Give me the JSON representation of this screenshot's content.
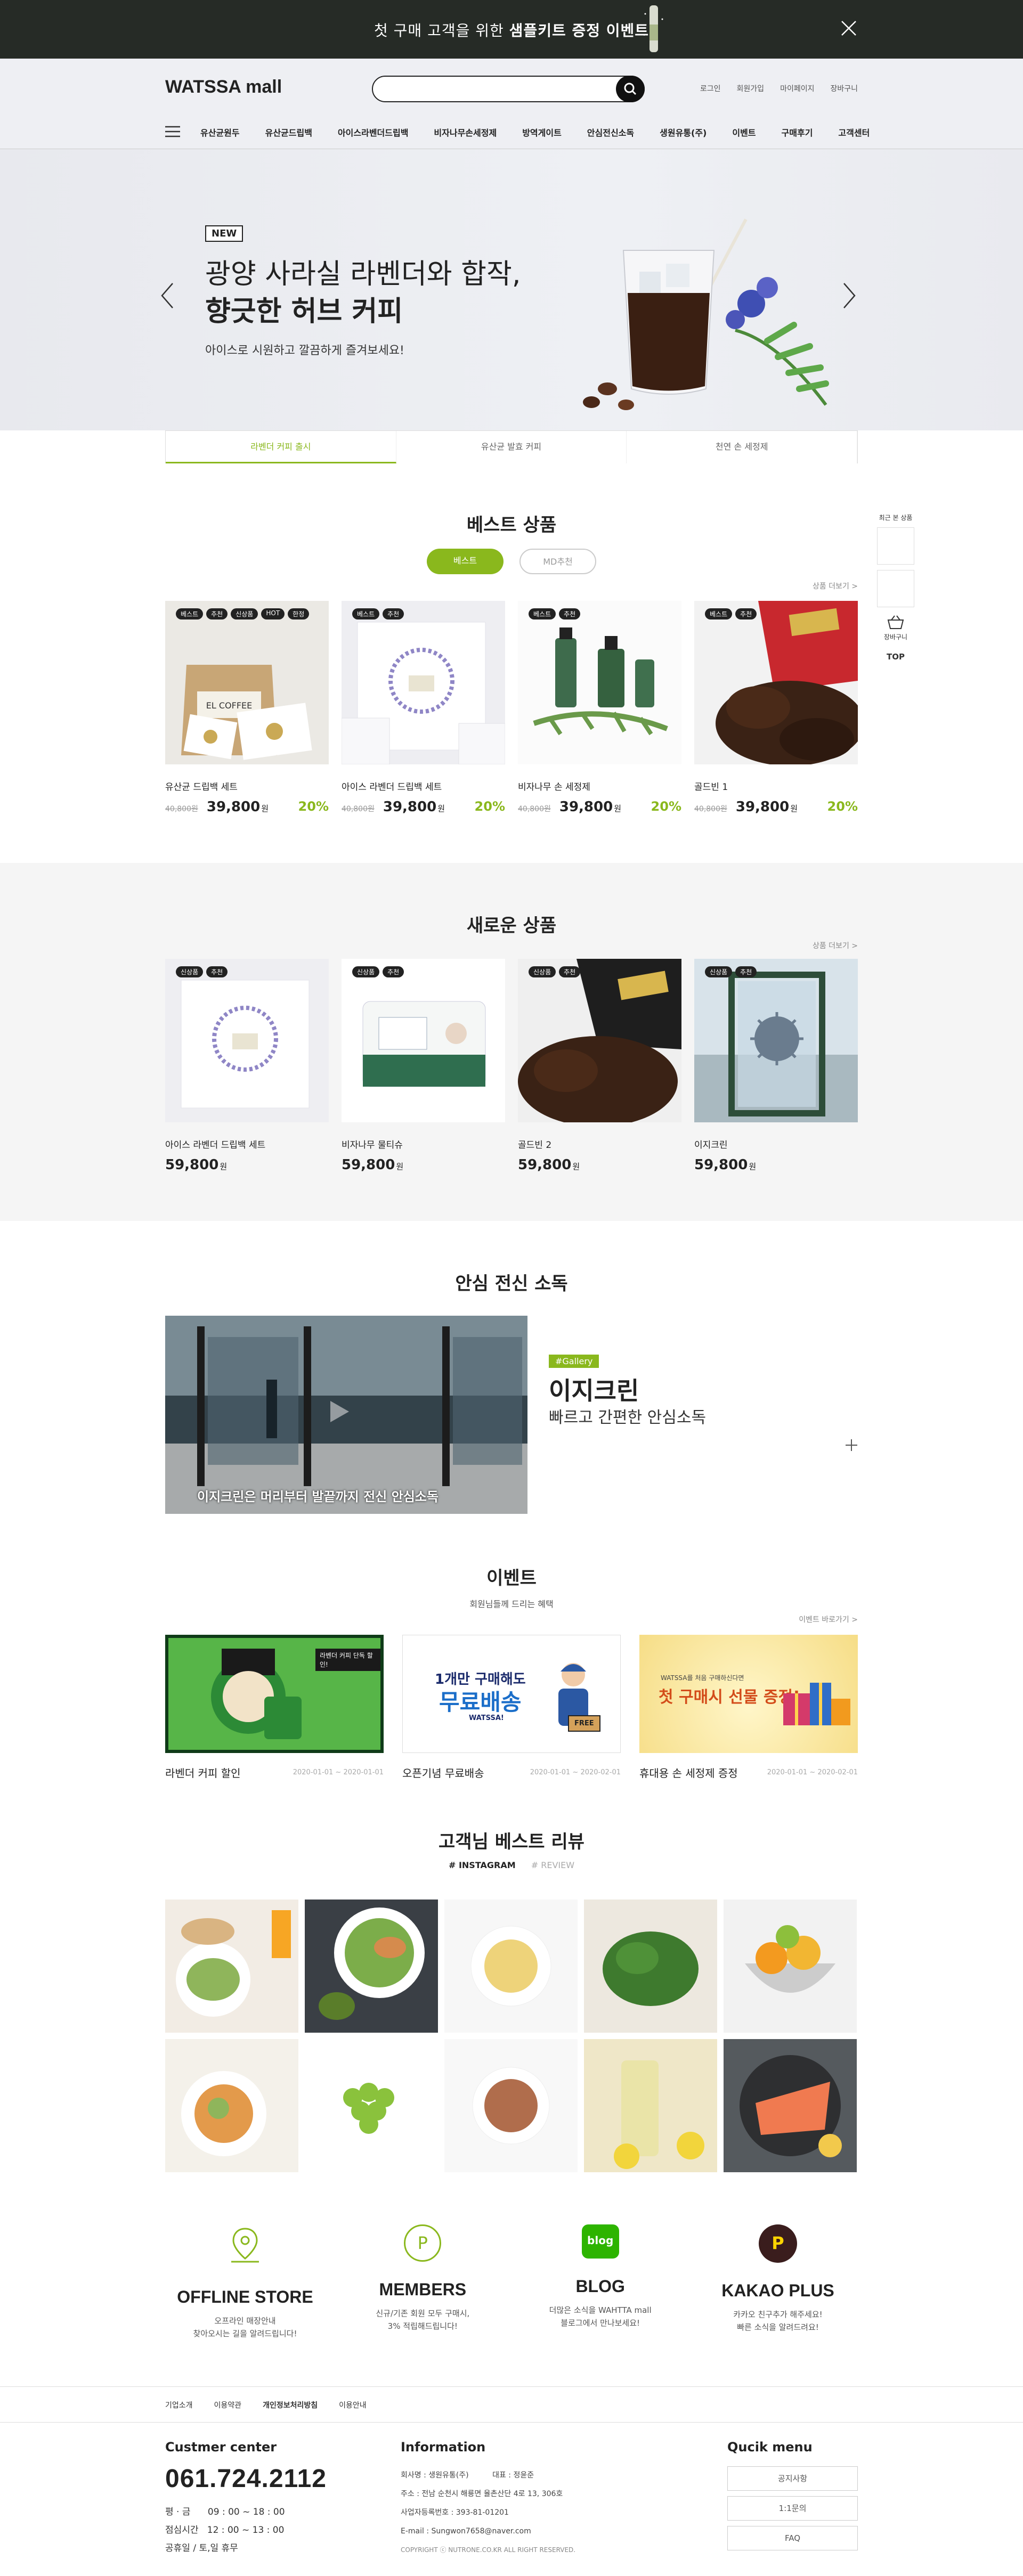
{
  "topbar": {
    "text_pre": "첫 구매 고객을 위한 ",
    "text_bold": "샘플키트 증정 이벤트"
  },
  "header": {
    "logo": "WATSSA mall",
    "search_placeholder": "",
    "links": [
      "로그인",
      "회원가입",
      "마이페이지",
      "장바구니"
    ],
    "menu": [
      "유산균원두",
      "유산균드립백",
      "아이스라벤더드립백",
      "비자나무손세정제",
      "방역게이트",
      "안심전신소독",
      "생원유통(주)",
      "이벤트",
      "구매후기",
      "고객센터"
    ]
  },
  "hero": {
    "badge": "NEW",
    "title_line1": "광양 사라실 라벤더와 합작,",
    "title_line2": "향긋한 허브 커피",
    "subtitle": "아이스로 시원하고 깔끔하게 즐겨보세요!",
    "tabs": [
      "라벤더 커피 출시",
      "유산균 발효 커피",
      "천연 손 세정제"
    ]
  },
  "best": {
    "title": "베스트 상품",
    "pill_on": "베스트",
    "pill_off": "MD추천",
    "more": "상품 더보기 >",
    "items": [
      {
        "name": "유산균 드립백 세트",
        "old": "40,800원",
        "price": "39,800",
        "won": "원",
        "pct": "20%",
        "badges": [
          "베스트",
          "추천",
          "신상품",
          "HOT",
          "한정"
        ]
      },
      {
        "name": "아이스 라벤더 드립백 세트",
        "old": "40,800원",
        "price": "39,800",
        "won": "원",
        "pct": "20%",
        "badges": [
          "베스트",
          "추천"
        ]
      },
      {
        "name": "비자나무 손 세정제",
        "old": "40,800원",
        "price": "39,800",
        "won": "원",
        "pct": "20%",
        "badges": [
          "베스트",
          "추천"
        ]
      },
      {
        "name": "골드빈 1",
        "old": "40,800원",
        "price": "39,800",
        "won": "원",
        "pct": "20%",
        "badges": [
          "베스트",
          "추천"
        ]
      }
    ]
  },
  "side": {
    "recent": "최근 본 상품",
    "cart": "장바구니",
    "top": "TOP"
  },
  "newp": {
    "title": "새로운 상품",
    "more": "상품 더보기 >",
    "items": [
      {
        "name": "아이스 라벤더 드립백 세트",
        "price": "59,800",
        "won": "원",
        "badges": [
          "신상품",
          "추천"
        ]
      },
      {
        "name": "비자나무 물티슈",
        "price": "59,800",
        "won": "원",
        "badges": [
          "신상품",
          "추천"
        ]
      },
      {
        "name": "골드빈 2",
        "price": "59,800",
        "won": "원",
        "badges": [
          "신상품",
          "추천"
        ]
      },
      {
        "name": "이지크린",
        "price": "59,800",
        "won": "원",
        "badges": [
          "신상품",
          "추천"
        ]
      }
    ]
  },
  "gallery": {
    "title": "안심 전신 소독",
    "tag": "#Gallery",
    "name": "이지크린",
    "desc": "빠르고 간편한 안심소독",
    "caption": "이지크린은 머리부터 발끝까지 전신 안심소독"
  },
  "events": {
    "title": "이벤트",
    "subtitle": "회원님들께 드리는 혜택",
    "more": "이벤트 바로가기 >",
    "items": [
      {
        "title": "라벤더 커피 할인",
        "date": "2020-01-01 ~ 2020-01-01",
        "banner": "라벤더 커피 단독 할인!"
      },
      {
        "title": "오픈기념 무료배송",
        "date": "2020-01-01 ~ 2020-02-01",
        "banner1": "1개만 구매해도",
        "banner2": "무료배송",
        "brand": "WATSSA!",
        "free": "FREE"
      },
      {
        "title": "휴대용 손 세정제 증정",
        "date": "2020-01-01 ~ 2020-02-01",
        "banner0": "WATSSA를 처음 구매하신다면",
        "banner1": "첫 구매시 선물 증정!"
      }
    ]
  },
  "reviews": {
    "title": "고객님 베스트 리뷰",
    "tab1": "# INSTAGRAM",
    "tab2": "# REVIEW"
  },
  "quad": [
    {
      "title": "OFFLINE STORE",
      "desc": "오프라인 매장안내\n찾아오시는 길을 알려드립니다!",
      "icon": "map-pin-icon"
    },
    {
      "title": "MEMBERS",
      "desc": "신규/기존 회원 모두 구매시,\n3% 적립해드립니다!",
      "icon": "point-icon",
      "glyph": "P"
    },
    {
      "title": "BLOG",
      "desc": "더많은 소식을 WAHTTA mall\n블로그에서 만나보세요!",
      "icon": "blog-icon",
      "glyph": "blog"
    },
    {
      "title": "KAKAO PLUS",
      "desc": "카카오 친구추가 해주세요!\n빠른 소식을 알려드려요!",
      "icon": "kakao-plus-icon",
      "glyph": "P"
    }
  ],
  "footer": {
    "links": [
      "기업소개",
      "이용약관",
      "개인정보처리방침",
      "이용안내"
    ],
    "cs_title": "Custmer center",
    "phone": "061.724.2112",
    "hours": [
      "평 · 금      09 : 00 ~ 18 : 00",
      "점심시간   12 : 00 ~ 13 : 00",
      "공휴일 / 토,일 휴무"
    ],
    "info_title": "Information",
    "info": [
      "회사명 : 생원유통(주)          대표 : 정윤준",
      "주소 : 전남 순천시 해룡면 율촌산단 4로 13, 306호",
      "사업자등록번호 : 393-81-01201",
      "E-mail : Sungwon7658@naver.com",
      "COPYRIGHT ⓒ NUTRONE.CO.KR ALL RIGHT RESERVED."
    ],
    "quick_title": "Qucik menu",
    "quick": [
      "공지사항",
      "1:1문의",
      "FAQ"
    ]
  }
}
